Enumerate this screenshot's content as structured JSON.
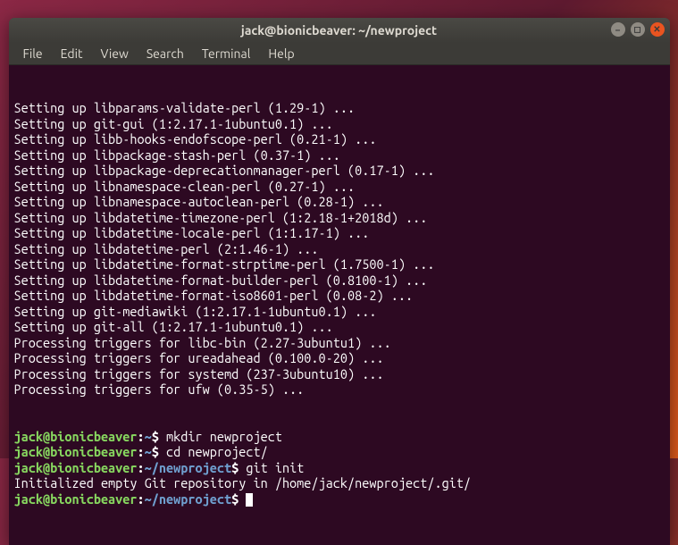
{
  "window": {
    "title": "jack@bionicbeaver: ~/newproject"
  },
  "menubar": {
    "items": [
      "File",
      "Edit",
      "View",
      "Search",
      "Terminal",
      "Help"
    ]
  },
  "colors": {
    "user_host": "#87d75f",
    "path": "#6f9fcf",
    "terminal_bg": "#2d0922",
    "close_btn": "#e95420"
  },
  "terminal": {
    "output_lines": [
      "Setting up libparams-validate-perl (1.29-1) ...",
      "Setting up git-gui (1:2.17.1-1ubuntu0.1) ...",
      "Setting up libb-hooks-endofscope-perl (0.21-1) ...",
      "Setting up libpackage-stash-perl (0.37-1) ...",
      "Setting up libpackage-deprecationmanager-perl (0.17-1) ...",
      "Setting up libnamespace-clean-perl (0.27-1) ...",
      "Setting up libnamespace-autoclean-perl (0.28-1) ...",
      "Setting up libdatetime-timezone-perl (1:2.18-1+2018d) ...",
      "Setting up libdatetime-locale-perl (1:1.17-1) ...",
      "Setting up libdatetime-perl (2:1.46-1) ...",
      "Setting up libdatetime-format-strptime-perl (1.7500-1) ...",
      "Setting up libdatetime-format-builder-perl (0.8100-1) ...",
      "Setting up libdatetime-format-iso8601-perl (0.08-2) ...",
      "Setting up git-mediawiki (1:2.17.1-1ubuntu0.1) ...",
      "Setting up git-all (1:2.17.1-1ubuntu0.1) ...",
      "Processing triggers for libc-bin (2.27-3ubuntu1) ...",
      "Processing triggers for ureadahead (0.100.0-20) ...",
      "Processing triggers for systemd (237-3ubuntu10) ...",
      "Processing triggers for ufw (0.35-5) ..."
    ],
    "prompts": [
      {
        "user_host": "jack@bionicbeaver",
        "sep": ":",
        "path": "~",
        "symbol": "$",
        "command": "mkdir newproject"
      },
      {
        "user_host": "jack@bionicbeaver",
        "sep": ":",
        "path": "~",
        "symbol": "$",
        "command": "cd newproject/"
      },
      {
        "user_host": "jack@bionicbeaver",
        "sep": ":",
        "path": "~/newproject",
        "symbol": "$",
        "command": "git init"
      }
    ],
    "post_init_line": "Initialized empty Git repository in /home/jack/newproject/.git/",
    "final_prompt": {
      "user_host": "jack@bionicbeaver",
      "sep": ":",
      "path": "~/newproject",
      "symbol": "$",
      "command": ""
    }
  }
}
